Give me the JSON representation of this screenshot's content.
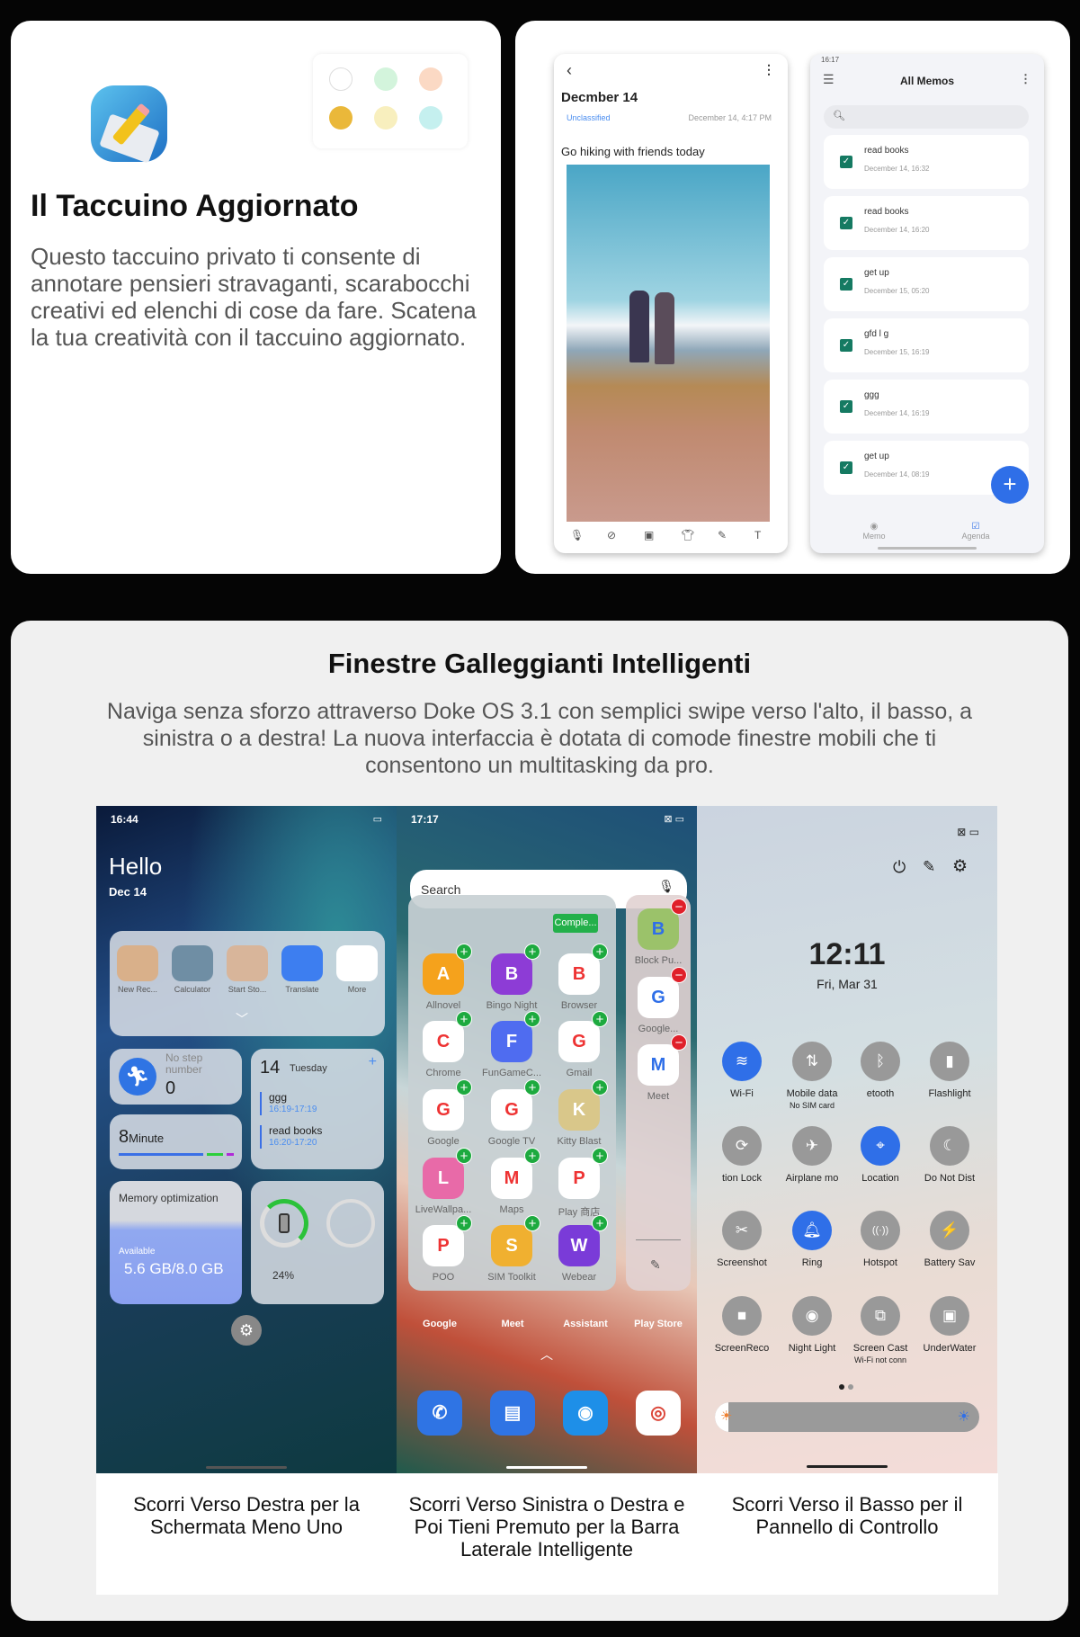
{
  "notebook": {
    "title": "Il Taccuino Aggiornato",
    "description": "Questo taccuino privato ti consente di annotare pensieri stravaganti, scarabocchi creativi ed elenchi di cose da fare. Scatena la tua creatività con il taccuino aggiornato.",
    "app_icon": "notepad-pencil-icon",
    "color_options": [
      "#ffffff",
      "#d3f4dc",
      "#fbd9c4",
      "#eab83a",
      "#f8efbe",
      "#c5f0ef"
    ]
  },
  "note_screen": {
    "title": "Decmber 14",
    "category": "Unclassified",
    "timestamp": "December 14, 4:17 PM",
    "body": "Go hiking with friends today",
    "toolbar_icons": [
      "microphone-icon",
      "checklist-icon",
      "image-icon",
      "shirt-icon",
      "pen-icon",
      "text-icon"
    ]
  },
  "memos_screen": {
    "status_time": "16:17",
    "title": "All Memos",
    "items": [
      {
        "title": "read books",
        "time": "December 14, 16:32"
      },
      {
        "title": "read books",
        "time": "December 14, 16:20"
      },
      {
        "title": "get up",
        "time": "December 15, 05:20"
      },
      {
        "title": "gfd l g",
        "time": "December 15, 16:19"
      },
      {
        "title": "ggg",
        "time": "December 14, 16:19"
      },
      {
        "title": "get up",
        "time": "December 14, 08:19"
      }
    ],
    "nav": [
      "Memo",
      "Agenda"
    ],
    "accent": "#2f6fe8"
  },
  "floating": {
    "title": "Finestre Galleggianti Intelligenti",
    "description": "Naviga senza sforzo attraverso Doke OS 3.1 con semplici swipe verso l'alto, il basso, a sinistra o a destra! La nuova interfaccia è dotata di comode finestre mobili che ti consentono un multitasking da pro."
  },
  "minus_one": {
    "status_time": "16:44",
    "greeting": "Hello",
    "date": "Dec 14",
    "shortcuts": [
      "New Rec...",
      "Calculator",
      "Start Sto...",
      "Translate",
      "More"
    ],
    "steps_label": "No step number",
    "steps_value": "0",
    "minutes_value": "8",
    "minutes_unit": "Minute",
    "calendar_day": "14",
    "calendar_weekday": "Tuesday",
    "events": [
      {
        "title": "ggg",
        "time": "16:19-17:19"
      },
      {
        "title": "read books",
        "time": "16:20-17:20"
      }
    ],
    "memory_title": "Memory optimization",
    "memory_label": "Available",
    "memory_value": "5.6 GB/8.0 GB",
    "battery_percent": "24%"
  },
  "sidebar": {
    "status_time": "17:17",
    "search_placeholder": "Search",
    "complete_label": "Comple...",
    "apps": [
      "Allnovel",
      "Bingo Night",
      "Browser",
      "Chrome",
      "FunGameC...",
      "Gmail",
      "Google",
      "Google TV",
      "Kitty Blast",
      "LiveWallpa...",
      "Maps",
      "Play 商店",
      "POO",
      "SIM Toolkit",
      "Webear"
    ],
    "app_colors": [
      "#f5a21c",
      "#8d3cd6",
      "#ffffff",
      "#ffffff",
      "#4f6cf0",
      "#ffffff",
      "#ffffff",
      "#ffffff",
      "#d9c78a",
      "#e86aa8",
      "#ffffff",
      "#ffffff",
      "#ffffff",
      "#f0b030",
      "#7a3bd8"
    ],
    "side_apps": [
      "Block Pu...",
      "Google...",
      "Meet"
    ],
    "dock_labels": [
      "Google",
      "Meet",
      "Assistant",
      "Play Store"
    ],
    "dock_apps": [
      "phone-icon",
      "messages-icon",
      "camera-icon",
      "chrome-icon"
    ]
  },
  "control_panel": {
    "clock": "12:11",
    "date": "Fri, Mar 31",
    "toggles": [
      {
        "label": "Wi-Fi",
        "icon": "wifi-icon",
        "on": true
      },
      {
        "label": "Mobile data",
        "sub": "No SIM card",
        "icon": "mobile-data-icon",
        "on": false
      },
      {
        "label": "etooth",
        "icon": "bluetooth-icon",
        "on": false
      },
      {
        "label": "Flashlight",
        "icon": "flashlight-icon",
        "on": false
      },
      {
        "label": "tion Lock",
        "icon": "rotation-lock-icon",
        "on": false
      },
      {
        "label": "Airplane mo",
        "icon": "airplane-icon",
        "on": false
      },
      {
        "label": "Location",
        "icon": "location-icon",
        "on": true
      },
      {
        "label": "Do Not Dist",
        "icon": "moon-icon",
        "on": false
      },
      {
        "label": "Screenshot",
        "icon": "screenshot-icon",
        "on": false
      },
      {
        "label": "Ring",
        "icon": "bell-icon",
        "on": true
      },
      {
        "label": "Hotspot",
        "icon": "hotspot-icon",
        "on": false
      },
      {
        "label": "Battery Sav",
        "icon": "battery-saver-icon",
        "on": false
      },
      {
        "label": "ScreenReco",
        "icon": "screen-record-icon",
        "on": false
      },
      {
        "label": "Night Light",
        "icon": "eye-icon",
        "on": false
      },
      {
        "label": "Screen Cast",
        "sub": "Wi-Fi not conn",
        "icon": "cast-icon",
        "on": false
      },
      {
        "label": "UnderWater",
        "icon": "underwater-camera-icon",
        "on": false
      }
    ],
    "brightness": 0.05,
    "page": 1,
    "pages": 2
  },
  "captions": [
    "Scorri Verso Destra per la Schermata Meno Uno",
    "Scorri Verso Sinistra o Destra e Poi Tieni Premuto per la Barra Laterale Intelligente",
    "Scorri Verso il Basso per il Pannello di Controllo"
  ]
}
